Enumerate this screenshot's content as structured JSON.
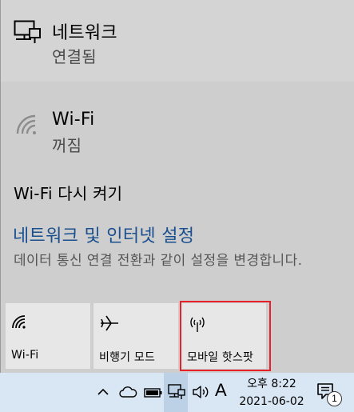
{
  "network_status": {
    "title": "네트워크",
    "status": "연결됨"
  },
  "wifi": {
    "title": "Wi-Fi",
    "status": "꺼짐",
    "turn_on_label": "Wi-Fi 다시 켜기"
  },
  "settings": {
    "link_label": "네트워크 및 인터넷 설정",
    "description": "데이터 통신 연결 전환과 같이 설정을 변경합니다."
  },
  "quick_actions": [
    {
      "label": "Wi-Fi",
      "icon": "wifi-icon"
    },
    {
      "label": "비행기 모드",
      "icon": "airplane-icon"
    },
    {
      "label": "모바일 핫스팟",
      "icon": "hotspot-icon"
    }
  ],
  "taskbar": {
    "ime_label": "A",
    "time": "오후 8:22",
    "date": "2021-06-02",
    "notification_count": "1"
  },
  "colors": {
    "link": "#1a4f8f",
    "highlight": "#e8202a",
    "taskbar": "#d9e6f3"
  }
}
